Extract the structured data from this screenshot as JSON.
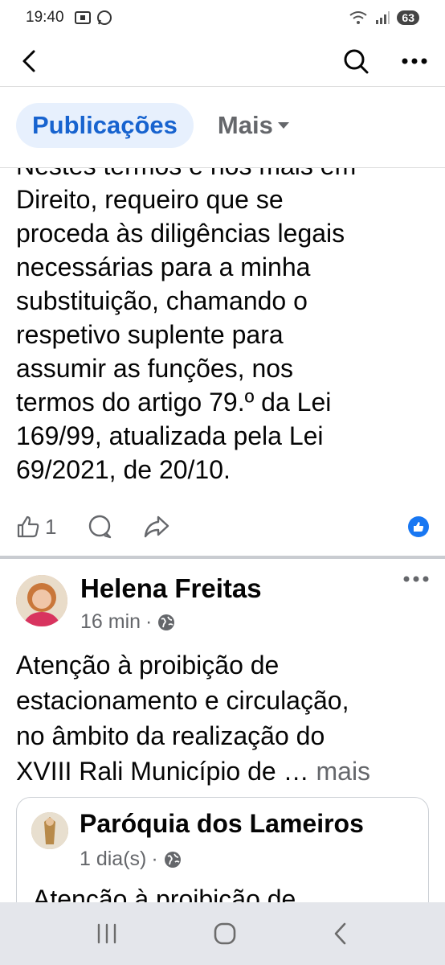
{
  "status": {
    "time": "19:40",
    "battery": "63",
    "icons": [
      "screenshot-icon",
      "whatsapp-icon",
      "wifi-icon",
      "signal-icon"
    ]
  },
  "nav": {
    "icons": [
      "back-arrow-icon",
      "search-icon",
      "more-icon"
    ]
  },
  "tabs": {
    "publications": "Publicações",
    "more": "Mais"
  },
  "post1": {
    "lines": [
      "Nestes termos e nos mais em",
      "Direito, requeiro que se",
      "proceda às diligências legais",
      "necessárias para a minha",
      "substituição, chamando o",
      "respetivo suplente para",
      "assumir as funções, nos",
      "termos do artigo 79.º da Lei",
      "169/99, atualizada pela Lei",
      "69/2021, de 20/10."
    ],
    "like_count": "1"
  },
  "post2": {
    "author": "Helena Freitas",
    "time": "16 min",
    "text_lines": [
      "Atenção à proibição de",
      "estacionamento e circulação,",
      "no âmbito da realização do",
      "XVIII Rali Município de …"
    ],
    "more_label": "mais",
    "shared": {
      "author": "Paróquia dos Lameiros",
      "time": "1 dia(s)",
      "text": "Atenção à proibição de"
    }
  },
  "colors": {
    "accent": "#1763cf",
    "tab_bg": "#e7f0fd",
    "like_blue": "#1877f2",
    "secondary_text": "#65676b"
  }
}
